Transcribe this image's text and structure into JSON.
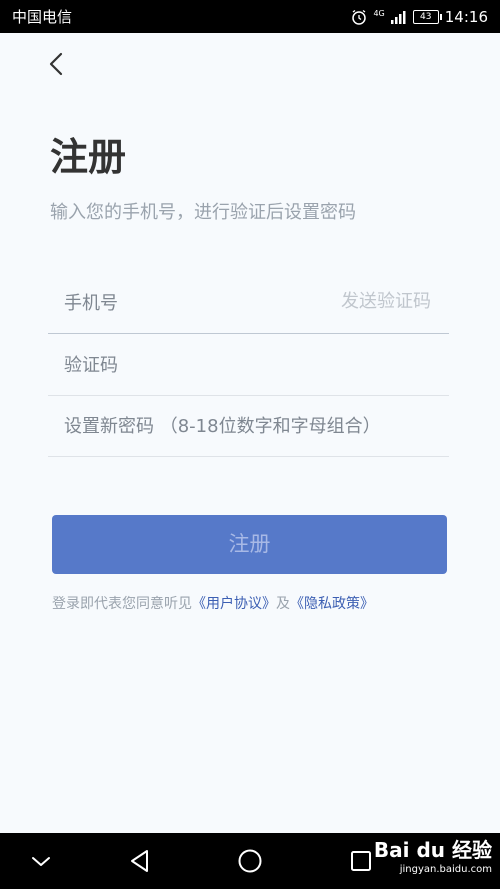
{
  "status_bar": {
    "carrier": "中国电信",
    "network": "4G",
    "battery": "43",
    "time": "14:16"
  },
  "header": {
    "back_icon": "chevron-left-icon",
    "title": "注册",
    "subtitle": "输入您的手机号，进行验证后设置密码"
  },
  "form": {
    "phone_placeholder": "手机号",
    "send_code_label": "发送验证码",
    "code_placeholder": "验证码",
    "password_placeholder": "设置新密码 （8-18位数字和字母组合）",
    "submit_label": "注册"
  },
  "agreement": {
    "prefix": "登录即代表您同意听见",
    "user_agreement": "《用户协议》",
    "conjunction": "及",
    "privacy_policy": "《隐私政策》"
  },
  "nav_bar": {
    "icons": [
      "chevron-down-icon",
      "back-triangle-icon",
      "home-circle-icon",
      "recents-square-icon"
    ]
  },
  "watermark": {
    "brand": "Bai du 经验",
    "url": "jingyan.baidu.com"
  },
  "colors": {
    "accent": "#5679c9",
    "link": "#3c5fb3",
    "background": "#f7fafd"
  }
}
